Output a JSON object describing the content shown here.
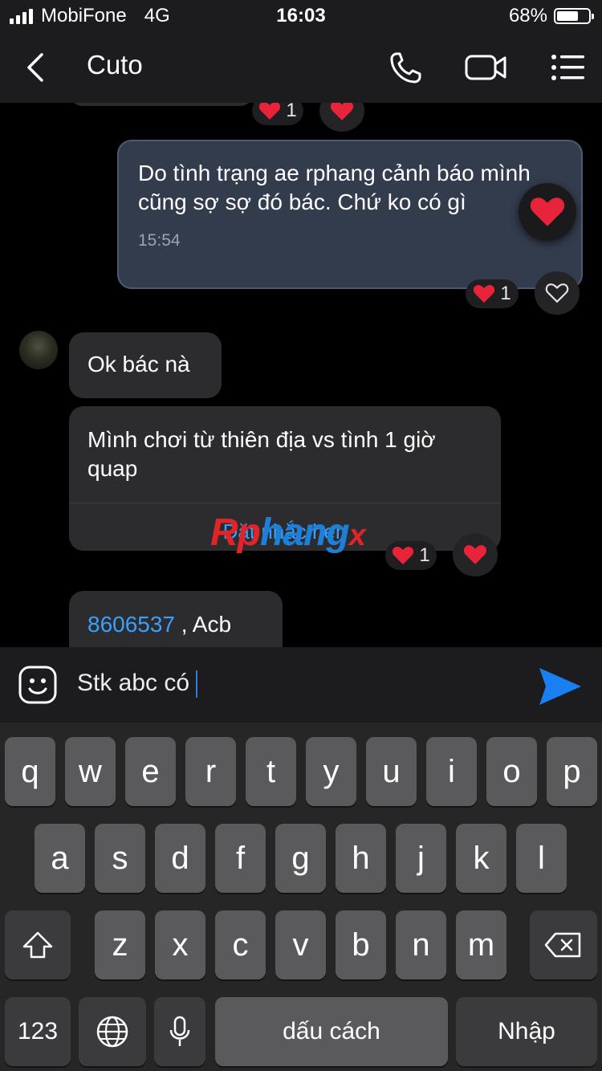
{
  "status_bar": {
    "carrier": "MobiFone",
    "network": "4G",
    "time": "16:03",
    "battery": "68%",
    "battery_level": 0.68
  },
  "header": {
    "title": "Cuto",
    "icons": [
      "back-icon",
      "phone-icon",
      "video-call-icon",
      "menu-list-icon"
    ]
  },
  "messages": [
    {
      "id": "m1",
      "sender": "me",
      "text": "Do tình trạng ae rphang cảnh báo mình cũng sợ sợ đó bác. Chứ ko có gì",
      "time": "15:54",
      "reaction_count": "1"
    },
    {
      "id": "m2",
      "sender": "other",
      "text": "Ok bác nà"
    },
    {
      "id": "m3",
      "sender": "other",
      "text": "Mình chơi từ thiên địa vs tình 1 giờ quap",
      "action": "Đặt nhắc hẹn",
      "reaction_count": "1"
    },
    {
      "id": "m4",
      "sender": "other",
      "link": "8606537",
      "text": " , Acb"
    }
  ],
  "top_partial_reaction_count": "1",
  "watermark": {
    "part1": "Rp",
    "part2": "hang",
    "part3": "x"
  },
  "composer": {
    "text": "Stk abc có"
  },
  "keyboard": {
    "row1": [
      "q",
      "w",
      "e",
      "r",
      "t",
      "y",
      "u",
      "i",
      "o",
      "p"
    ],
    "row2": [
      "a",
      "s",
      "d",
      "f",
      "g",
      "h",
      "j",
      "k",
      "l"
    ],
    "row3": [
      "z",
      "x",
      "c",
      "v",
      "b",
      "n",
      "m"
    ],
    "numbers_key": "123",
    "space_key": "dấu cách",
    "return_key": "Nhập"
  },
  "colors": {
    "my_bubble": "#333c4d",
    "other_bubble": "#2c2c2e",
    "heart": "#e8243b",
    "send": "#1a7ff0",
    "link": "#3aa0ff"
  }
}
